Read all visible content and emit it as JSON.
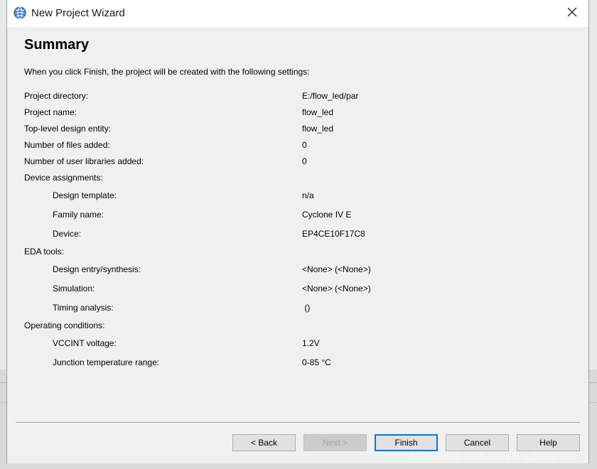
{
  "window": {
    "title": "New Project Wizard",
    "app_icon": "quartus-globe-icon",
    "close_icon": "close-icon"
  },
  "summary": {
    "heading": "Summary",
    "intro": "When you click Finish, the project will be created with the following settings:",
    "rows": [
      {
        "label": "Project directory:",
        "value": "E:/flow_led/par"
      },
      {
        "label": "Project name:",
        "value": "flow_led"
      },
      {
        "label": "Top-level design entity:",
        "value": "flow_led"
      },
      {
        "label": "Number of files added:",
        "value": "0"
      },
      {
        "label": "Number of user libraries added:",
        "value": "0"
      },
      {
        "label": "Device assignments:",
        "value": ""
      },
      {
        "label": "Design template:",
        "value": "n/a"
      },
      {
        "label": "Family name:",
        "value": "Cyclone IV E"
      },
      {
        "label": "Device:",
        "value": "EP4CE10F17C8"
      },
      {
        "label": "EDA tools:",
        "value": ""
      },
      {
        "label": "Design entry/synthesis:",
        "value": "<None> (<None>)"
      },
      {
        "label": "Simulation:",
        "value": "<None> (<None>)"
      },
      {
        "label": "Timing analysis:",
        "value": " ()"
      },
      {
        "label": "Operating conditions:",
        "value": ""
      },
      {
        "label": "VCCINT voltage:",
        "value": "1.2V"
      },
      {
        "label": "Junction temperature range:",
        "value": "0-85 °C"
      }
    ]
  },
  "buttons": {
    "back": "< Back",
    "next": "Next >",
    "finish": "Finish",
    "cancel": "Cancel",
    "help": "Help"
  },
  "watermark": "https://blog.csdn.net/yang_jiangning",
  "colors": {
    "accent": "#0078d7",
    "disabled_text": "#a0a0a0"
  }
}
